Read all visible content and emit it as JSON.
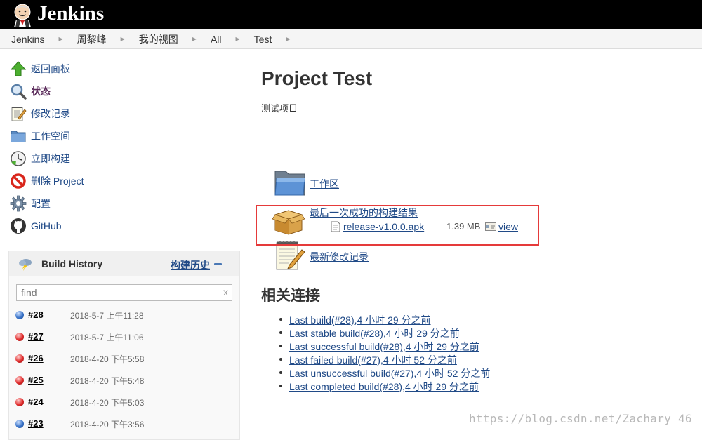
{
  "header": {
    "brand": "Jenkins"
  },
  "breadcrumbs": [
    "Jenkins",
    "周黎峰",
    "我的视图",
    "All",
    "Test"
  ],
  "tasks": [
    {
      "label": "返回面板",
      "icon": "up-arrow-icon"
    },
    {
      "label": "状态",
      "icon": "magnifier-icon",
      "current": true
    },
    {
      "label": "修改记录",
      "icon": "notepad-icon"
    },
    {
      "label": "工作空间",
      "icon": "folder-icon"
    },
    {
      "label": "立即构建",
      "icon": "clock-build-icon"
    },
    {
      "label": "删除 Project",
      "icon": "no-entry-icon"
    },
    {
      "label": "配置",
      "icon": "gear-icon"
    },
    {
      "label": "GitHub",
      "icon": "github-icon"
    }
  ],
  "build_history": {
    "title": "Build History",
    "trend_link": "构建历史",
    "search_placeholder": "find",
    "clear": "x",
    "builds": [
      {
        "number": "#28",
        "date": "2018-5-7 上午11:28",
        "status": "blue"
      },
      {
        "number": "#27",
        "date": "2018-5-7 上午11:06",
        "status": "red"
      },
      {
        "number": "#26",
        "date": "2018-4-20 下午5:58",
        "status": "red"
      },
      {
        "number": "#25",
        "date": "2018-4-20 下午5:48",
        "status": "red"
      },
      {
        "number": "#24",
        "date": "2018-4-20 下午5:03",
        "status": "red"
      },
      {
        "number": "#23",
        "date": "2018-4-20 下午3:56",
        "status": "blue"
      }
    ]
  },
  "main": {
    "title": "Project Test",
    "description": "测试项目",
    "workspace_link": "工作区",
    "last_success_link": "最后一次成功的构建结果",
    "artifact": {
      "name": "release-v1.0.0.apk",
      "size": "1.39 MB",
      "view": "view"
    },
    "changes_link": "最新修改记录",
    "related_title": "相关连接",
    "permalinks": [
      "Last build(#28),4 小时 29 分之前",
      "Last stable build(#28),4 小时 29 分之前",
      "Last successful build(#28),4 小时 29 分之前",
      "Last failed build(#27),4 小时 52 分之前",
      "Last unsuccessful build(#27),4 小时 52 分之前",
      "Last completed build(#28),4 小时 29 分之前"
    ]
  },
  "watermark": "https://blog.csdn.net/Zachary_46",
  "colors": {
    "header_bg": "#000000",
    "link": "#204a87",
    "highlight_border": "#e53a3a"
  }
}
